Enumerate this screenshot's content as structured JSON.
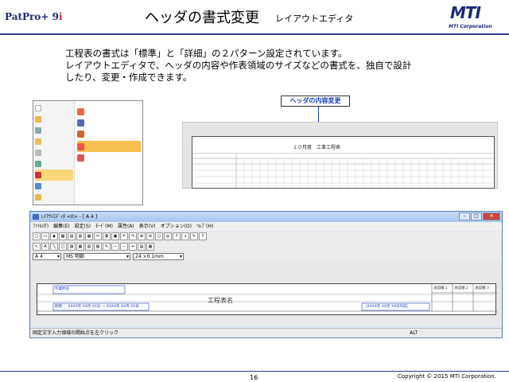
{
  "header": {
    "logo_text": "PatPro+ 9",
    "logo_i": "i",
    "title": "ヘッダの書式変更",
    "subtitle": "レイアウトエディタ",
    "mti_mark": "MTI",
    "mti_corp": "MTI Corporation"
  },
  "description": [
    "工程表の書式は「標準」と「詳細」の２パターン設定されています。",
    "レイアウトエディタで、ヘッダの内容や作表領域のサイズなどの書式を、独自で設計",
    "したり、変更・作成できます。"
  ],
  "callout": "ヘッダの内容変更",
  "preview": {
    "sheet_title": "１０月度　工事工程表"
  },
  "window": {
    "title": "ﾚｲｱｳﾄｴﾃﾞｨﾀ  <0>  - [ A 4 ]",
    "menus": [
      "ﾌｧｲﾙ(F)",
      "編集(E)",
      "設定(S)",
      "ﾓｰﾄﾞ(M)",
      "属性(A)",
      "表示(V)",
      "オプション(O)",
      "ﾍﾙﾌﾟ(H)"
    ],
    "paper": "A 4",
    "font": "MS 明朝",
    "size": "24 ×0.1mm",
    "doc_cells": {
      "c1": "作業所名",
      "c2": "工程表名",
      "c3": "期間 ： XXXX年 XX月 XX日  ～  XXXX年 XX月 XX日",
      "c4": "（XXXX年 XX月 XX日作成）",
      "s1": "承認欄 1",
      "s2": "承認欄 2",
      "s3": "承認欄 3"
    },
    "status": "固定文字入力領域の開始点を左クリック",
    "status_alt": "ALT"
  },
  "footer": {
    "page": "16",
    "copyright": "Copyright © 2015 MTI Corporation."
  }
}
